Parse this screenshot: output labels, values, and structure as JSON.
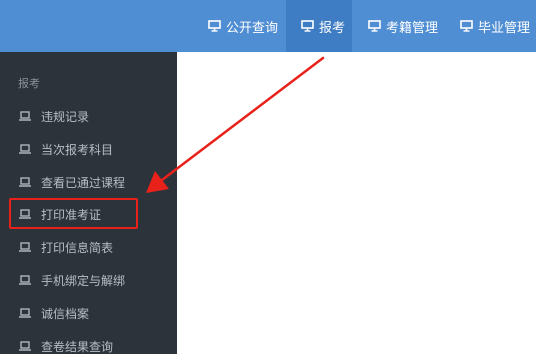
{
  "topnav": {
    "items": [
      {
        "label": "公开查询",
        "icon": "monitor-icon"
      },
      {
        "label": "报考",
        "icon": "monitor-icon",
        "active": true
      },
      {
        "label": "考籍管理",
        "icon": "monitor-icon"
      },
      {
        "label": "毕业管理",
        "icon": "monitor-icon"
      }
    ]
  },
  "sidebar": {
    "section_title": "报考",
    "items": [
      {
        "label": "违规记录",
        "icon": "laptop-icon"
      },
      {
        "label": "当次报考科目",
        "icon": "laptop-icon"
      },
      {
        "label": "查看已通过课程",
        "icon": "laptop-icon"
      },
      {
        "label": "打印准考证",
        "icon": "laptop-icon",
        "highlighted": true
      },
      {
        "label": "打印信息简表",
        "icon": "laptop-icon"
      },
      {
        "label": "手机绑定与解绑",
        "icon": "laptop-icon"
      },
      {
        "label": "诚信档案",
        "icon": "laptop-icon"
      },
      {
        "label": "查卷结果查询",
        "icon": "laptop-icon"
      }
    ]
  },
  "colors": {
    "topbar": "#4f8ed3",
    "topbar_active": "#3e7dc3",
    "sidebar": "#2c333a",
    "sidebar_text": "#b8bec5",
    "annotation": "#e8211b"
  }
}
